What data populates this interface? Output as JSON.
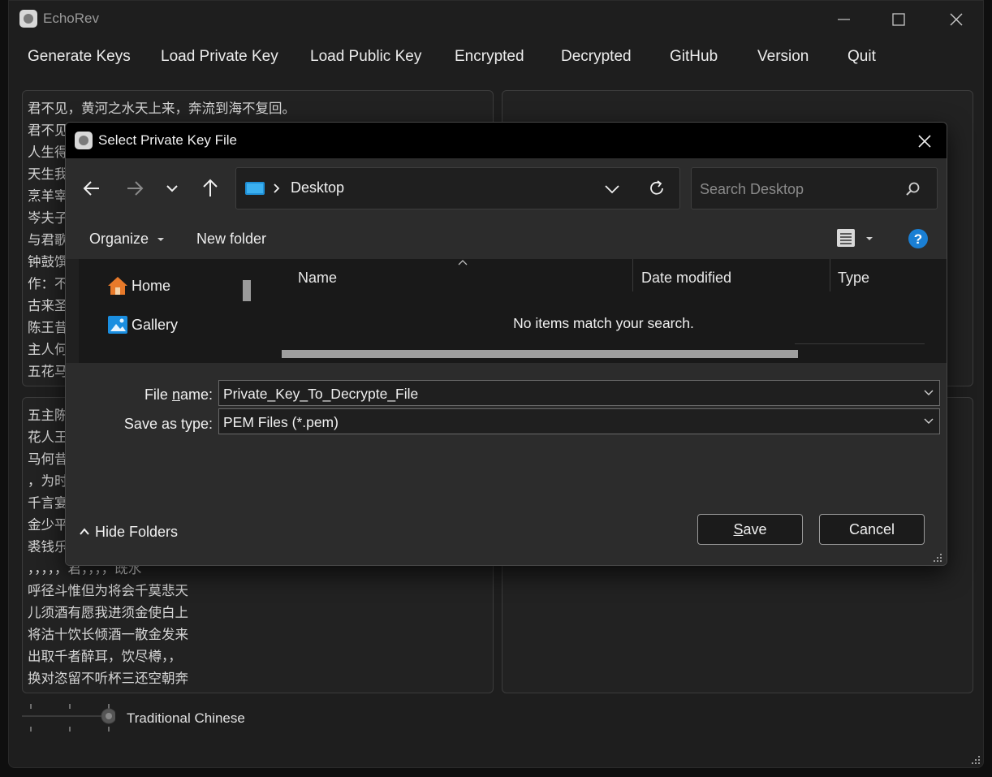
{
  "app": {
    "title": "EchoRev"
  },
  "menu": [
    "Generate Keys",
    "Load Private Key",
    "Load Public Key",
    "Encrypted",
    "Decrypted",
    "GitHub",
    "Version",
    "Quit"
  ],
  "panels": {
    "top_left_lines": [
      "君不见，黄河之水天上来，奔流到海不复回。",
      "君不见",
      "人生得",
      "天生我",
      "烹羊宰",
      "岑夫子",
      "与君歌",
      "钟鼓馔",
      "作：不",
      "古来圣",
      "陈王昔",
      "主人何",
      "五花马"
    ],
    "bottom_left_lines": [
      "五主陈",
      "花人王",
      "马何昔",
      "，为时",
      "千言宴",
      "金少平",
      "裘钱乐",
      "，，，，，君，，，，既水",
      "呼径斗惟但为将会千莫悲天",
      "儿须酒有愿我进须金使白上",
      "将沽十饮长倾酒一散金发来",
      "出取千者醉耳，饮尽樽，，",
      "换对恣留不听杯三还空朝奔"
    ]
  },
  "slider": {
    "label": "Traditional Chinese"
  },
  "dialog": {
    "title": "Select Private Key File",
    "address": "Desktop",
    "search_placeholder": "Search Desktop",
    "organize": "Organize",
    "new_folder": "New folder",
    "nav_items": [
      {
        "label": "Home",
        "icon": "home-icon"
      },
      {
        "label": "Gallery",
        "icon": "gallery-icon"
      }
    ],
    "columns": [
      "Name",
      "Date modified",
      "Type"
    ],
    "empty_message": "No items match your search.",
    "file_name_label_prefix": "File ",
    "file_name_label_underlined": "n",
    "file_name_label_suffix": "ame:",
    "file_name_value": "Private_Key_To_Decrypte_File",
    "save_type_label": "Save as type:",
    "save_type_value": "PEM Files (*.pem)",
    "save_underlined": "S",
    "save_rest": "ave",
    "cancel": "Cancel",
    "hide_folders": "Hide Folders"
  },
  "colors": {
    "accent": "#1a7fd4",
    "dialog_bg": "#2c2c2c",
    "window_bg": "#1e1e1e"
  }
}
